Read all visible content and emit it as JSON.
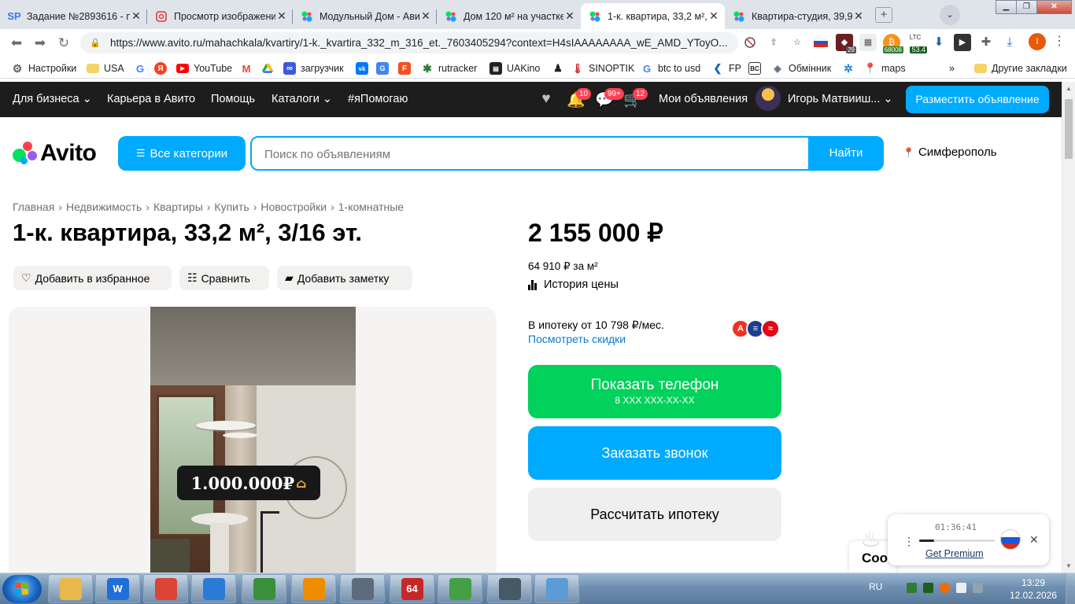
{
  "browser": {
    "tabs": [
      {
        "title": "Задание №2893616 - п",
        "favicon": "SP",
        "color": "#3b78e7"
      },
      {
        "title": "Просмотр изображени",
        "favicon": "image-viewer-icon",
        "color": "#e53935"
      },
      {
        "title": "Модульный Дом - Авит",
        "favicon": "avito-icon",
        "color": "#00aaff"
      },
      {
        "title": "Дом 120 м² на участке",
        "favicon": "avito-icon",
        "color": "#00aaff"
      },
      {
        "title": "1-к. квартира, 33,2 м², 3",
        "favicon": "avito-icon",
        "color": "#00aaff"
      },
      {
        "title": "Квартира-студия, 39,9 м",
        "favicon": "avito-icon",
        "color": "#00aaff"
      }
    ],
    "url": "https://www.avito.ru/mahachkala/kvartiry/1-k._kvartira_332_m_316_et._7603405294?context=H4sIAAAAAAAA_wE_AMD_YToyO...",
    "extensions": {
      "badge_1": "29",
      "badge_2": "68008",
      "ltc_label": "LTC",
      "ltc_value": "53.4",
      "profile_letter": "I"
    },
    "bookmarks": [
      {
        "label": "Настройки",
        "icon": "gear-icon"
      },
      {
        "label": "USA",
        "icon": "folder-icon"
      },
      {
        "label": "",
        "icon": "google-icon"
      },
      {
        "label": "",
        "icon": "yandex-icon"
      },
      {
        "label": "YouTube",
        "icon": "youtube-icon"
      },
      {
        "label": "",
        "icon": "gmail-icon"
      },
      {
        "label": "",
        "icon": "drive-icon"
      },
      {
        "label": "загрузчик",
        "icon": "infinity-icon"
      },
      {
        "label": "",
        "icon": "vk-icon"
      },
      {
        "label": "",
        "icon": "translate-icon"
      },
      {
        "label": "",
        "icon": "f-icon"
      },
      {
        "label": "rutracker",
        "icon": "rutracker-icon"
      },
      {
        "label": "UAKino",
        "icon": "uakino-icon"
      },
      {
        "label": "",
        "icon": "figure-icon"
      },
      {
        "label": "SINOPTIK",
        "icon": "thermometer-icon"
      },
      {
        "label": "btc to usd",
        "icon": "google-icon"
      },
      {
        "label": "FP",
        "icon": "fp-icon"
      },
      {
        "label": "",
        "icon": "bc-icon"
      },
      {
        "label": "Обмінник",
        "icon": "exchange-icon"
      },
      {
        "label": "",
        "icon": "snowflake-icon"
      },
      {
        "label": "maps",
        "icon": "maps-icon"
      }
    ],
    "more_bookmarks": "»",
    "other_bookmarks": "Другие закладки"
  },
  "avito": {
    "topnav": {
      "business": "Для бизнеса",
      "career": "Карьера в Авито",
      "help": "Помощь",
      "catalogs": "Каталоги",
      "ihelp": "#яПомогаю",
      "notifications_badge": "10",
      "messages_badge": "99+",
      "cart_badge": "12",
      "my_ads": "Мои объявления",
      "user_name": "Игорь Матвииш...",
      "post_ad": "Разместить объявление"
    },
    "logo_text": "Avito",
    "search": {
      "categories_label": "Все категории",
      "placeholder": "Поиск по объявлениям",
      "find_label": "Найти",
      "city": "Симферополь"
    },
    "breadcrumbs": [
      "Главная",
      "Недвижимость",
      "Квартиры",
      "Купить",
      "Новостройки",
      "1-комнатные"
    ],
    "listing": {
      "title": "1-к. квартира, 33,2 м², 3/16 эт.",
      "add_favorite": "Добавить в избранное",
      "compare": "Сравнить",
      "add_note": "Добавить заметку",
      "photo_overlay_price": "1.000.000₽",
      "price": "2 155 000 ₽",
      "price_per_sqm": "64 910 ₽ за м²",
      "price_history": "История цены",
      "mortgage_text": "В ипотеку от 10 798 ₽/мес.",
      "see_discounts": "Посмотреть скидки",
      "banks": [
        {
          "letter": "А",
          "color": "#ef3124"
        },
        {
          "letter": "≡",
          "color": "#1a3f8f"
        },
        {
          "letter": "≈",
          "color": "#e30613"
        }
      ],
      "show_phone": "Показать телефон",
      "phone_mask": "8 XXX XXX-XX-XX",
      "order_call": "Заказать звонок",
      "calc_mortgage": "Рассчитать ипотеку"
    },
    "cookie_popup_text": "Coo"
  },
  "vpn_widget": {
    "timer": "01:36:41",
    "progress": 0.2,
    "premium_link": "Get Premium"
  },
  "taskbar": {
    "apps": [
      {
        "name": "explorer-icon",
        "label": "",
        "color": "#e8b84a"
      },
      {
        "name": "wise-icon",
        "label": "W",
        "color": "#1e6fd9"
      },
      {
        "name": "chrome-icon",
        "label": "",
        "color": "#db4437"
      },
      {
        "name": "network-icon",
        "label": "",
        "color": "#2a7bd6"
      },
      {
        "name": "calculator-icon",
        "label": "",
        "color": "#3a8f3a"
      },
      {
        "name": "media-player-icon",
        "label": "",
        "color": "#f08c00"
      },
      {
        "name": "clock-app-icon",
        "label": "",
        "color": "#5d6b7d"
      },
      {
        "name": "aida64-icon",
        "label": "64",
        "color": "#c62828"
      },
      {
        "name": "umbrella-icon",
        "label": "",
        "color": "#43a047"
      },
      {
        "name": "remote-desktop-icon",
        "label": "",
        "color": "#455a64"
      },
      {
        "name": "notepad-icon",
        "label": "",
        "color": "#5c9bd6"
      }
    ],
    "language": "RU",
    "time": "13:29",
    "date": "12.02.2026"
  }
}
